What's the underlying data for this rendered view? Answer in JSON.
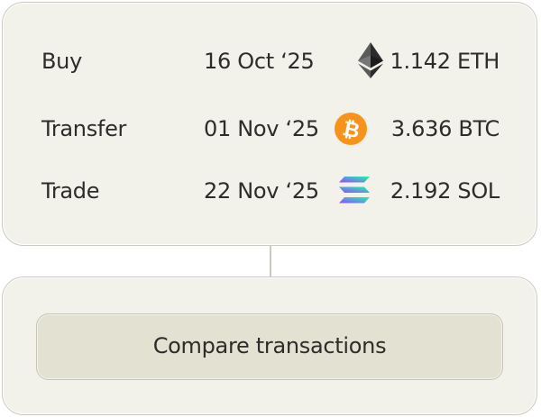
{
  "transactions": [
    {
      "type": "Buy",
      "date": "16 Oct ‘25",
      "amount": "1.142 ETH",
      "icon": "ethereum-icon"
    },
    {
      "type": "Transfer",
      "date": "01 Nov ‘25",
      "amount": "3.636 BTC",
      "icon": "bitcoin-icon"
    },
    {
      "type": "Trade",
      "date": "22 Nov ‘25",
      "amount": "2.192 SOL",
      "icon": "solana-icon"
    }
  ],
  "compare_button": {
    "label": "Compare transactions"
  },
  "colors": {
    "card_bg": "#f3f2ea",
    "button_bg": "#e3e1d1",
    "bitcoin": "#f7931a",
    "text": "#2c2c2a"
  }
}
